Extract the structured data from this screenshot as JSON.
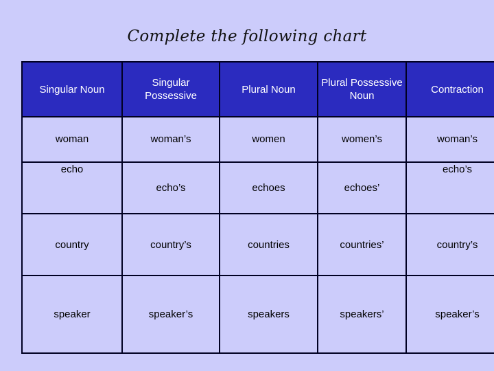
{
  "slide": {
    "title": "Complete the following chart",
    "background_color": "#ccccfb",
    "header_background_color": "#2b2bbf",
    "header_text_color": "#ffffff",
    "border_color": "#000022"
  },
  "table": {
    "headers": [
      "Singular Noun",
      "Singular Possessive",
      "Plural Noun",
      "Plural Possessive Noun",
      "Contraction"
    ],
    "rows": [
      {
        "singular_noun": "woman",
        "singular_possessive": "woman’s",
        "plural_noun": "women",
        "plural_possessive_noun": "women’s",
        "contraction": "woman’s"
      },
      {
        "singular_noun": "echo",
        "singular_possessive": "echo’s",
        "plural_noun": "echoes",
        "plural_possessive_noun": "echoes’",
        "contraction": "echo’s"
      },
      {
        "singular_noun": "country",
        "singular_possessive": "country’s",
        "plural_noun": "countries",
        "plural_possessive_noun": "countries’",
        "contraction": "country’s"
      },
      {
        "singular_noun": "speaker",
        "singular_possessive": "speaker’s",
        "plural_noun": "speakers",
        "plural_possessive_noun": "speakers’",
        "contraction": "speaker’s"
      }
    ]
  }
}
